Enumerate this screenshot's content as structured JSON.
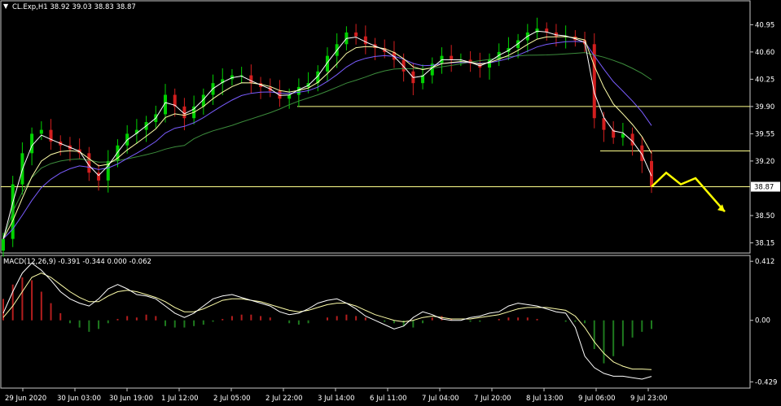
{
  "symbol_line": "CL.Exp,H1  38.92 39.03 38.83 38.87",
  "macd_line": "MACD(12,26,9) -0.391 -0.344 0.000 -0.062",
  "colors": {
    "background": "#000000",
    "bull": "#00d200",
    "bear": "#d21e1e",
    "ma_fast": "#ffffff",
    "ma_mid": "#ffffaa",
    "ma_slow_purple": "#7a5cff",
    "ma_slow_green": "#3c8c3c",
    "level_line": "#ffff8c",
    "arrow": "#ffff00",
    "macd_hist_pos": "#b41e1e",
    "macd_hist_neg": "#1e7a1e",
    "macd_signal": "#ffffaa",
    "macd_main": "#ffffff"
  },
  "chart_data": [
    {
      "type": "candlestick",
      "title": "CL.Exp,H1",
      "ohlc_last": {
        "open": 38.92,
        "high": 39.03,
        "low": 38.83,
        "close": 38.87
      },
      "y_ticks": [
        "40.95",
        "40.60",
        "40.25",
        "39.90",
        "39.55",
        "39.20",
        "38.87",
        "38.50",
        "38.15"
      ],
      "ylim": [
        38.05,
        41.1
      ],
      "current_price": "38.87",
      "levels": [
        39.9,
        39.33,
        38.87
      ],
      "x_ticks": [
        "29 Jun 2020",
        "30 Jun 03:00",
        "30 Jun 19:00",
        "1 Jul 12:00",
        "2 Jul 05:00",
        "2 Jul 22:00",
        "3 Jul 14:00",
        "6 Jul 11:00",
        "7 Jul 04:00",
        "7 Jul 20:00",
        "8 Jul 13:00",
        "9 Jul 06:00",
        "9 Jul 23:00"
      ],
      "close_series": [
        38.2,
        38.9,
        39.3,
        39.55,
        39.6,
        39.45,
        39.4,
        39.35,
        39.3,
        39.05,
        38.95,
        39.2,
        39.4,
        39.55,
        39.6,
        39.7,
        39.8,
        40.05,
        39.9,
        39.75,
        39.9,
        40.05,
        40.2,
        40.25,
        40.3,
        40.3,
        40.2,
        40.15,
        40.1,
        40.0,
        40.05,
        40.15,
        40.2,
        40.35,
        40.55,
        40.7,
        40.85,
        40.8,
        40.7,
        40.65,
        40.6,
        40.5,
        40.35,
        40.2,
        40.3,
        40.45,
        40.55,
        40.5,
        40.5,
        40.45,
        40.4,
        40.5,
        40.6,
        40.65,
        40.75,
        40.85,
        40.9,
        40.85,
        40.8,
        40.8,
        40.75,
        40.7,
        39.75,
        39.6,
        39.5,
        39.55,
        39.4,
        39.2,
        38.87
      ],
      "forecast_path": [
        38.87,
        39.05,
        38.9,
        38.98,
        38.55
      ]
    },
    {
      "type": "macd",
      "title": "MACD(12,26,9)",
      "params": [
        12,
        26,
        9
      ],
      "values": {
        "main": -0.391,
        "signal": -0.344,
        "histogram_a": 0.0,
        "histogram_b": -0.062
      },
      "y_ticks": [
        "0.412",
        "0.00",
        "-0.429"
      ],
      "ylim": [
        -0.45,
        0.43
      ],
      "histogram": [
        0.15,
        0.25,
        0.3,
        0.28,
        0.2,
        0.12,
        0.05,
        -0.02,
        -0.05,
        -0.08,
        -0.06,
        -0.02,
        0.01,
        0.03,
        0.02,
        0.04,
        0.03,
        -0.04,
        -0.05,
        -0.05,
        -0.04,
        -0.03,
        -0.01,
        0.01,
        0.03,
        0.04,
        0.04,
        0.03,
        0.02,
        0.0,
        -0.02,
        -0.03,
        -0.02,
        0.0,
        0.02,
        0.03,
        0.04,
        0.03,
        0.02,
        0.0,
        -0.01,
        -0.02,
        -0.04,
        -0.05,
        -0.02,
        0.02,
        0.03,
        0.01,
        0.0,
        -0.01,
        -0.01,
        0.0,
        0.01,
        0.02,
        0.02,
        0.02,
        0.01,
        0.0,
        0.0,
        -0.01,
        -0.01,
        -0.02,
        -0.2,
        -0.3,
        -0.25,
        -0.18,
        -0.12,
        -0.08,
        -0.06
      ],
      "main": [
        0.05,
        0.2,
        0.33,
        0.4,
        0.35,
        0.28,
        0.2,
        0.15,
        0.12,
        0.1,
        0.15,
        0.22,
        0.25,
        0.22,
        0.18,
        0.17,
        0.15,
        0.1,
        0.05,
        0.02,
        0.05,
        0.1,
        0.15,
        0.17,
        0.18,
        0.16,
        0.14,
        0.12,
        0.1,
        0.06,
        0.04,
        0.05,
        0.08,
        0.12,
        0.14,
        0.15,
        0.12,
        0.08,
        0.03,
        0.0,
        -0.03,
        -0.06,
        -0.04,
        0.02,
        0.06,
        0.04,
        0.01,
        0.0,
        0.0,
        0.02,
        0.03,
        0.05,
        0.06,
        0.1,
        0.12,
        0.11,
        0.1,
        0.08,
        0.06,
        0.05,
        -0.05,
        -0.25,
        -0.33,
        -0.37,
        -0.39,
        -0.39,
        -0.4,
        -0.41,
        -0.391
      ],
      "signal": [
        0.02,
        0.1,
        0.2,
        0.3,
        0.33,
        0.3,
        0.25,
        0.2,
        0.16,
        0.13,
        0.13,
        0.17,
        0.2,
        0.21,
        0.2,
        0.18,
        0.16,
        0.13,
        0.09,
        0.06,
        0.06,
        0.08,
        0.11,
        0.14,
        0.15,
        0.15,
        0.14,
        0.13,
        0.11,
        0.09,
        0.07,
        0.06,
        0.07,
        0.09,
        0.11,
        0.12,
        0.12,
        0.1,
        0.07,
        0.04,
        0.02,
        0.0,
        -0.01,
        0.0,
        0.02,
        0.03,
        0.02,
        0.01,
        0.01,
        0.01,
        0.02,
        0.03,
        0.04,
        0.06,
        0.08,
        0.09,
        0.09,
        0.09,
        0.08,
        0.07,
        0.03,
        -0.05,
        -0.15,
        -0.23,
        -0.29,
        -0.32,
        -0.34,
        -0.34,
        -0.344
      ]
    }
  ]
}
